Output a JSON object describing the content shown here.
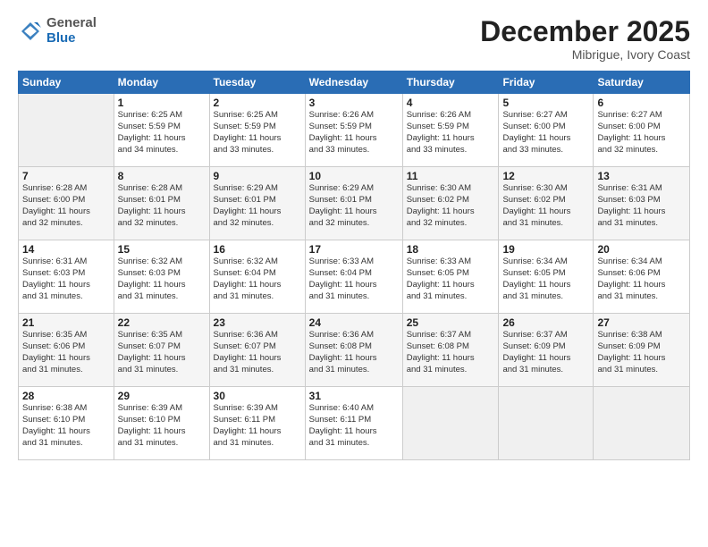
{
  "header": {
    "logo_general": "General",
    "logo_blue": "Blue",
    "month_title": "December 2025",
    "location": "Mibrigue, Ivory Coast"
  },
  "calendar": {
    "days_of_week": [
      "Sunday",
      "Monday",
      "Tuesday",
      "Wednesday",
      "Thursday",
      "Friday",
      "Saturday"
    ],
    "weeks": [
      [
        {
          "day": "",
          "info": ""
        },
        {
          "day": "1",
          "info": "Sunrise: 6:25 AM\nSunset: 5:59 PM\nDaylight: 11 hours\nand 34 minutes."
        },
        {
          "day": "2",
          "info": "Sunrise: 6:25 AM\nSunset: 5:59 PM\nDaylight: 11 hours\nand 33 minutes."
        },
        {
          "day": "3",
          "info": "Sunrise: 6:26 AM\nSunset: 5:59 PM\nDaylight: 11 hours\nand 33 minutes."
        },
        {
          "day": "4",
          "info": "Sunrise: 6:26 AM\nSunset: 5:59 PM\nDaylight: 11 hours\nand 33 minutes."
        },
        {
          "day": "5",
          "info": "Sunrise: 6:27 AM\nSunset: 6:00 PM\nDaylight: 11 hours\nand 33 minutes."
        },
        {
          "day": "6",
          "info": "Sunrise: 6:27 AM\nSunset: 6:00 PM\nDaylight: 11 hours\nand 32 minutes."
        }
      ],
      [
        {
          "day": "7",
          "info": "Sunrise: 6:28 AM\nSunset: 6:00 PM\nDaylight: 11 hours\nand 32 minutes."
        },
        {
          "day": "8",
          "info": "Sunrise: 6:28 AM\nSunset: 6:01 PM\nDaylight: 11 hours\nand 32 minutes."
        },
        {
          "day": "9",
          "info": "Sunrise: 6:29 AM\nSunset: 6:01 PM\nDaylight: 11 hours\nand 32 minutes."
        },
        {
          "day": "10",
          "info": "Sunrise: 6:29 AM\nSunset: 6:01 PM\nDaylight: 11 hours\nand 32 minutes."
        },
        {
          "day": "11",
          "info": "Sunrise: 6:30 AM\nSunset: 6:02 PM\nDaylight: 11 hours\nand 32 minutes."
        },
        {
          "day": "12",
          "info": "Sunrise: 6:30 AM\nSunset: 6:02 PM\nDaylight: 11 hours\nand 31 minutes."
        },
        {
          "day": "13",
          "info": "Sunrise: 6:31 AM\nSunset: 6:03 PM\nDaylight: 11 hours\nand 31 minutes."
        }
      ],
      [
        {
          "day": "14",
          "info": "Sunrise: 6:31 AM\nSunset: 6:03 PM\nDaylight: 11 hours\nand 31 minutes."
        },
        {
          "day": "15",
          "info": "Sunrise: 6:32 AM\nSunset: 6:03 PM\nDaylight: 11 hours\nand 31 minutes."
        },
        {
          "day": "16",
          "info": "Sunrise: 6:32 AM\nSunset: 6:04 PM\nDaylight: 11 hours\nand 31 minutes."
        },
        {
          "day": "17",
          "info": "Sunrise: 6:33 AM\nSunset: 6:04 PM\nDaylight: 11 hours\nand 31 minutes."
        },
        {
          "day": "18",
          "info": "Sunrise: 6:33 AM\nSunset: 6:05 PM\nDaylight: 11 hours\nand 31 minutes."
        },
        {
          "day": "19",
          "info": "Sunrise: 6:34 AM\nSunset: 6:05 PM\nDaylight: 11 hours\nand 31 minutes."
        },
        {
          "day": "20",
          "info": "Sunrise: 6:34 AM\nSunset: 6:06 PM\nDaylight: 11 hours\nand 31 minutes."
        }
      ],
      [
        {
          "day": "21",
          "info": "Sunrise: 6:35 AM\nSunset: 6:06 PM\nDaylight: 11 hours\nand 31 minutes."
        },
        {
          "day": "22",
          "info": "Sunrise: 6:35 AM\nSunset: 6:07 PM\nDaylight: 11 hours\nand 31 minutes."
        },
        {
          "day": "23",
          "info": "Sunrise: 6:36 AM\nSunset: 6:07 PM\nDaylight: 11 hours\nand 31 minutes."
        },
        {
          "day": "24",
          "info": "Sunrise: 6:36 AM\nSunset: 6:08 PM\nDaylight: 11 hours\nand 31 minutes."
        },
        {
          "day": "25",
          "info": "Sunrise: 6:37 AM\nSunset: 6:08 PM\nDaylight: 11 hours\nand 31 minutes."
        },
        {
          "day": "26",
          "info": "Sunrise: 6:37 AM\nSunset: 6:09 PM\nDaylight: 11 hours\nand 31 minutes."
        },
        {
          "day": "27",
          "info": "Sunrise: 6:38 AM\nSunset: 6:09 PM\nDaylight: 11 hours\nand 31 minutes."
        }
      ],
      [
        {
          "day": "28",
          "info": "Sunrise: 6:38 AM\nSunset: 6:10 PM\nDaylight: 11 hours\nand 31 minutes."
        },
        {
          "day": "29",
          "info": "Sunrise: 6:39 AM\nSunset: 6:10 PM\nDaylight: 11 hours\nand 31 minutes."
        },
        {
          "day": "30",
          "info": "Sunrise: 6:39 AM\nSunset: 6:11 PM\nDaylight: 11 hours\nand 31 minutes."
        },
        {
          "day": "31",
          "info": "Sunrise: 6:40 AM\nSunset: 6:11 PM\nDaylight: 11 hours\nand 31 minutes."
        },
        {
          "day": "",
          "info": ""
        },
        {
          "day": "",
          "info": ""
        },
        {
          "day": "",
          "info": ""
        }
      ]
    ]
  }
}
